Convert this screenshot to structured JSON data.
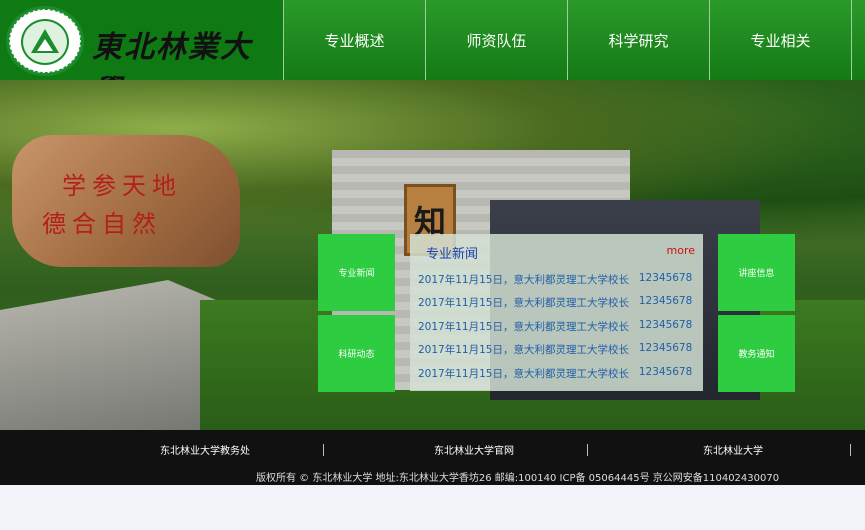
{
  "header": {
    "university_name": "東北林業大學",
    "seal_text": "NORTHEAST FORESTRY UNIVERSITY"
  },
  "nav": {
    "items": [
      {
        "label": "专业概述"
      },
      {
        "label": "师资队伍"
      },
      {
        "label": "科学研究"
      },
      {
        "label": "专业相关"
      },
      {
        "label": ""
      }
    ]
  },
  "hero": {
    "rock_line1": "学参天地",
    "rock_line2": "德合自然",
    "board_char": "知"
  },
  "tiles": {
    "major_news": "专业新闻",
    "research_news": "科研动态",
    "lectures": "讲座信息",
    "teaching_notice": "教务通知"
  },
  "news": {
    "title": "专业新闻",
    "more": "more",
    "items": [
      {
        "text": "2017年11月15日，意大利都灵理工大学校长",
        "num": "12345678"
      },
      {
        "text": "2017年11月15日，意大利都灵理工大学校长",
        "num": "12345678"
      },
      {
        "text": "2017年11月15日，意大利都灵理工大学校长",
        "num": "12345678"
      },
      {
        "text": "2017年11月15日，意大利都灵理工大学校长",
        "num": "12345678"
      },
      {
        "text": "2017年11月15日，意大利都灵理工大学校长",
        "num": "12345678"
      }
    ]
  },
  "footer": {
    "links": [
      "东北林业大学教务处",
      "东北林业大学官网",
      "东北林业大学"
    ],
    "copyright": "版权所有 © 东北林业大学 地址:东北林业大学香坊26 邮编:100140 ICP备 05064445号 京公网安备110402430070"
  },
  "colors": {
    "header_green": "#157a15",
    "tile_green": "#2ecc40",
    "news_title_blue": "#1a3fb0",
    "news_link_blue": "#1f5fa8",
    "more_red": "#d01010",
    "footer_bg": "#111111"
  }
}
